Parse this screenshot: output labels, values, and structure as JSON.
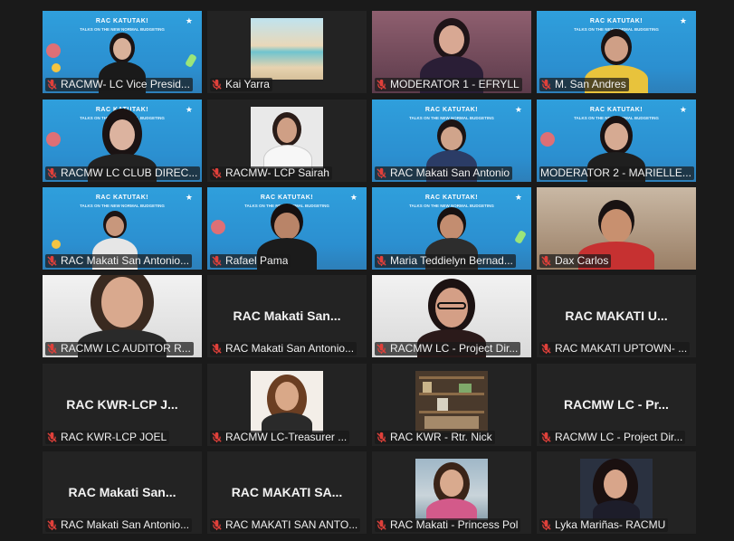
{
  "participants": [
    {
      "name": "RACMW- LC Vice Presid...",
      "muted": true,
      "video": "poster"
    },
    {
      "name": "Kai Yarra",
      "muted": true,
      "video": "photo-beach"
    },
    {
      "name": "MODERATOR 1 - EFRYLL",
      "muted": true,
      "video": "camera"
    },
    {
      "name": "M. San Andres",
      "muted": true,
      "video": "poster"
    },
    {
      "name": "RACMW LC CLUB DIREC...",
      "muted": true,
      "video": "poster"
    },
    {
      "name": "RACMW- LCP Sairah",
      "muted": true,
      "video": "photo-person"
    },
    {
      "name": "RAC Makati San Antonio",
      "muted": true,
      "video": "poster"
    },
    {
      "name": "MODERATOR 2 - MARIELLE...",
      "muted": false,
      "video": "poster",
      "active": true
    },
    {
      "name": "RAC Makati San Antonio...",
      "muted": true,
      "video": "poster"
    },
    {
      "name": "Rafael Pama",
      "muted": true,
      "video": "poster"
    },
    {
      "name": "Maria Teddielyn Bernad...",
      "muted": true,
      "video": "poster"
    },
    {
      "name": "Dax Carlos",
      "muted": true,
      "video": "camera"
    },
    {
      "name": "RACMW LC AUDITOR R...",
      "muted": true,
      "video": "camera"
    },
    {
      "name": "RAC Makati San Antonio...",
      "muted": true,
      "video": "off",
      "display": "RAC Makati San..."
    },
    {
      "name": "RACMW LC - Project Dir...",
      "muted": true,
      "video": "camera"
    },
    {
      "name": "RAC MAKATI UPTOWN- ...",
      "muted": true,
      "video": "off",
      "display": "RAC MAKATI U..."
    },
    {
      "name": "RAC KWR-LCP JOEL",
      "muted": true,
      "video": "off",
      "display": "RAC KWR-LCP J..."
    },
    {
      "name": "RACMW LC-Treasurer ...",
      "muted": true,
      "video": "photo-person"
    },
    {
      "name": "RAC KWR - Rtr. Nick",
      "muted": true,
      "video": "photo-shelf"
    },
    {
      "name": "RACMW LC - Project Dir...",
      "muted": true,
      "video": "off",
      "display": "RACMW LC - Pr..."
    },
    {
      "name": "RAC Makati San Antonio...",
      "muted": true,
      "video": "off",
      "display": "RAC Makati San..."
    },
    {
      "name": "RAC MAKATI SAN ANTO...",
      "muted": true,
      "video": "off",
      "display": "RAC MAKATI SA..."
    },
    {
      "name": "RAC Makati - Princess Pol",
      "muted": true,
      "video": "photo-person"
    },
    {
      "name": "Lyka Mariñas- RACMU",
      "muted": true,
      "video": "photo-person"
    }
  ],
  "poster": {
    "title": "RAC KATUTAK!",
    "subtitle": "TALKS ON THE NEW NORMAL BUDGETING"
  },
  "colors": {
    "active_border": "#d6df3f",
    "mute_icon": "#e0403a",
    "poster_bg": "#2f9fdc"
  }
}
